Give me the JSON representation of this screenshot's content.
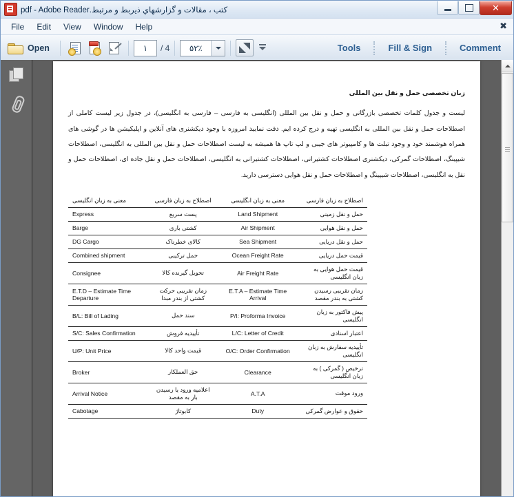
{
  "window": {
    "title": "کتب ، مقالات و گزارشهاي ذيربط و مرتبط.pdf - Adobe Reader",
    "app_icon": "adobe-reader-icon",
    "controls": {
      "minimize": "minimize-button",
      "restore": "restore-button",
      "close": "close-button"
    }
  },
  "menubar": {
    "items": [
      {
        "label": "File"
      },
      {
        "label": "Edit"
      },
      {
        "label": "View"
      },
      {
        "label": "Window"
      },
      {
        "label": "Help"
      }
    ],
    "close_doc": "✖"
  },
  "toolbar": {
    "open_label": "Open",
    "create_pdf_icon": "create-pdf-icon",
    "export_pdf_icon": "export-pdf-icon",
    "edit_pdf_icon": "edit-pdf-icon",
    "page_current": "۱",
    "page_total": "/ 4",
    "zoom_value": "۵۲٪",
    "fit_icon": "fit-page-icon",
    "view_menu_icon": "view-options-caret",
    "tools_label": "Tools",
    "fill_sign_label": "Fill & Sign",
    "comment_label": "Comment",
    "accent": "#2d5f92"
  },
  "navpane": {
    "page_thumbnails_icon": "page-thumbnails-icon",
    "attachments_icon": "paperclip-attachments-icon",
    "background": "#656565"
  },
  "document": {
    "heading": "زبان تخصصی حمل و نقل بین المللی",
    "paragraph": "لیست و جدول کلمات تخصصی بازرگانی و حمل و نقل بین المللی (انگلیسی به فارسی – فارسی به انگلیسی)، در جدول زیر لیست کاملی از اصطلاحات حمل و نقل بین المللی به انگلیسی تهیه و درج کرده ایم. دقت نمایید امروزه با وجود دیکشنری های آنلاین و اپلیکیشن ها در گوشی های همراه هوشمند خود و وجود تبلت ها و کامپیوتر های جیبی و لپ تاپ ها همیشه به لیست اصطلاحات حمل و نقل بین المللی به انگلیسی، اصطلاحات شیپینگ، اصطلاحات گمرکی، دیکشنری اصطلاحات کشتیرانی، اصطلاحات کشتیرانی به انگلیسی، اصطلاحات حمل و نقل جاده ای، اصطلاحات حمل و نقل به انگلیسی، اصطلاحات شیپینگ و اصطلاحات حمل و نقل هوایی دسترسی دارید.",
    "table": {
      "headers": {
        "col1_en_meaning": "معنی به زبان انگلیسی",
        "col2_fa_term": "اصطلاح به زبان فارسی",
        "col3_en_meaning": "معنی به زبان انگلیسی",
        "col4_fa_term": "اصطلاح به زبان فارسی"
      },
      "rows": [
        {
          "en1": "Express",
          "fa1": "پست سریع",
          "en2": "Land Shipment",
          "fa2": "حمل و نقل زمینی"
        },
        {
          "en1": "Barge",
          "fa1": "کشتی باری",
          "en2": "Air Shipment",
          "fa2": "حمل و نقل هوایی"
        },
        {
          "en1": "DG Cargo",
          "fa1": "کالای خطرناک",
          "en2": "Sea Shipment",
          "fa2": "حمل و نقل دریایی"
        },
        {
          "en1": "Combined shipment",
          "fa1": "حمل ترکیبی",
          "en2": "Ocean Freight Rate",
          "fa2": "قیمت حمل دریایی"
        },
        {
          "en1": "Consignee",
          "fa1": "تحویل گیرنده کالا",
          "en2": "Air Freight Rate",
          "fa2": "قیمت حمل هوایی به زبان انگلیسی"
        },
        {
          "en1": "E.T.D – Estimate Time Departure",
          "fa1": "زمان تقریبی حرکت کشتی از بندر مبدا",
          "en2": "E.T.A – Estimate Time Arrival",
          "fa2": "زمان تقریبی رسیدن کشتی به بندر مقصد"
        },
        {
          "en1": "B/L: Bill of Lading",
          "fa1": "سند حمل",
          "en2": "P/I: Proforma Invoice",
          "fa2": "پیش فاکتور به زبان انگلیسی"
        },
        {
          "en1": "S/C: Sales Confirmation",
          "fa1": "تأییدیه فروش",
          "en2": "L/C: Letter of Credit",
          "fa2": "اعتبار اسنادی"
        },
        {
          "en1": "U/P: Unit Price",
          "fa1": "قیمت واحد کالا",
          "en2": "O/C: Order Confirmation",
          "fa2": "تأییدیه سفارش به زبان انگلیسی"
        },
        {
          "en1": "Broker",
          "fa1": "حق العملکار",
          "en2": "Clearance",
          "fa2": "ترخیص ( گمرکی ) به زبان انگلیسی"
        },
        {
          "en1": "Arrival Notice",
          "fa1": "اعلامیه ورود یا رسیدن بار به مقصد",
          "en2": "A.T.A",
          "fa2": "ورود موقت"
        },
        {
          "en1": "Cabotage",
          "fa1": "کابوتاژ",
          "en2": "Duty",
          "fa2": "حقوق و عوارض گمرکی"
        }
      ]
    }
  },
  "scrollbar": {
    "up_arrow": "scroll-up-arrow",
    "thumb": "scroll-thumb"
  }
}
